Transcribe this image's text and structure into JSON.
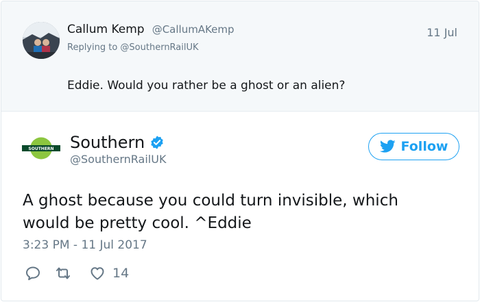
{
  "parent_tweet": {
    "author_name": "Callum Kemp",
    "author_handle": "@CallumAKemp",
    "date": "11 Jul",
    "replying_to": "Replying to @SouthernRailUK",
    "text": "Eddie. Would you rather be a ghost or an alien?"
  },
  "main_tweet": {
    "author_name": "Southern",
    "author_handle": "@SouthernRailUK",
    "avatar_text": "SOUTHERN",
    "follow_label": "Follow",
    "text": "A ghost because you could turn invisible, which would be pretty cool. ^Eddie",
    "timestamp": "3:23 PM - 11 Jul 2017",
    "like_count": "14",
    "icons": {
      "verified": "verified-badge-icon",
      "follow": "twitter-bird-icon",
      "reply": "reply-icon",
      "retweet": "retweet-icon",
      "like": "heart-icon"
    }
  },
  "colors": {
    "accent": "#1da1f2",
    "muted": "#657786",
    "text": "#14171a",
    "parent_bg": "#f5f8fa",
    "southern_green": "#8cc63f",
    "southern_dark": "#0b4a2c"
  }
}
